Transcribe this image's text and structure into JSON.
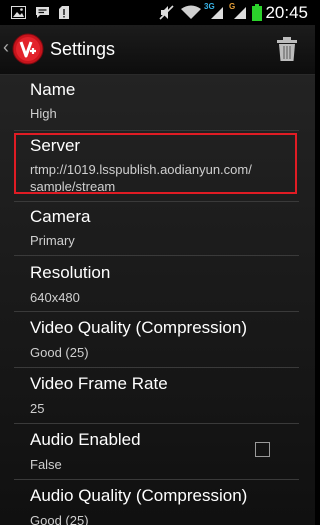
{
  "status_bar": {
    "time": "20:45",
    "net_left": "3G",
    "net_right": "G",
    "icons": [
      "image-icon",
      "message-icon",
      "sdcard-icon",
      "mute-icon",
      "wifi-icon",
      "signal-icon",
      "signal-icon",
      "battery-icon"
    ]
  },
  "action_bar": {
    "title": "Settings",
    "up_caret": "‹"
  },
  "settings": {
    "name": {
      "title": "Name",
      "value": "High"
    },
    "server": {
      "title": "Server",
      "value_line1": "rtmp://1019.lsspublish.aodianyun.com/",
      "value_line2": "sample/stream"
    },
    "camera": {
      "title": "Camera",
      "value": "Primary"
    },
    "resolution": {
      "title": "Resolution",
      "value": "640x480"
    },
    "video_quality": {
      "title": "Video Quality (Compression)",
      "value": "Good (25)"
    },
    "frame_rate": {
      "title": "Video Frame Rate",
      "value": "25"
    },
    "audio_enabled": {
      "title": "Audio Enabled",
      "value": "False",
      "checked": false
    },
    "audio_quality": {
      "title": "Audio Quality (Compression)",
      "value": "Good (25)"
    }
  },
  "colors": {
    "highlight": "#e01c24",
    "battery": "#2bd32b",
    "net_3g": "#39b4e8",
    "net_g": "#e8a13a"
  }
}
